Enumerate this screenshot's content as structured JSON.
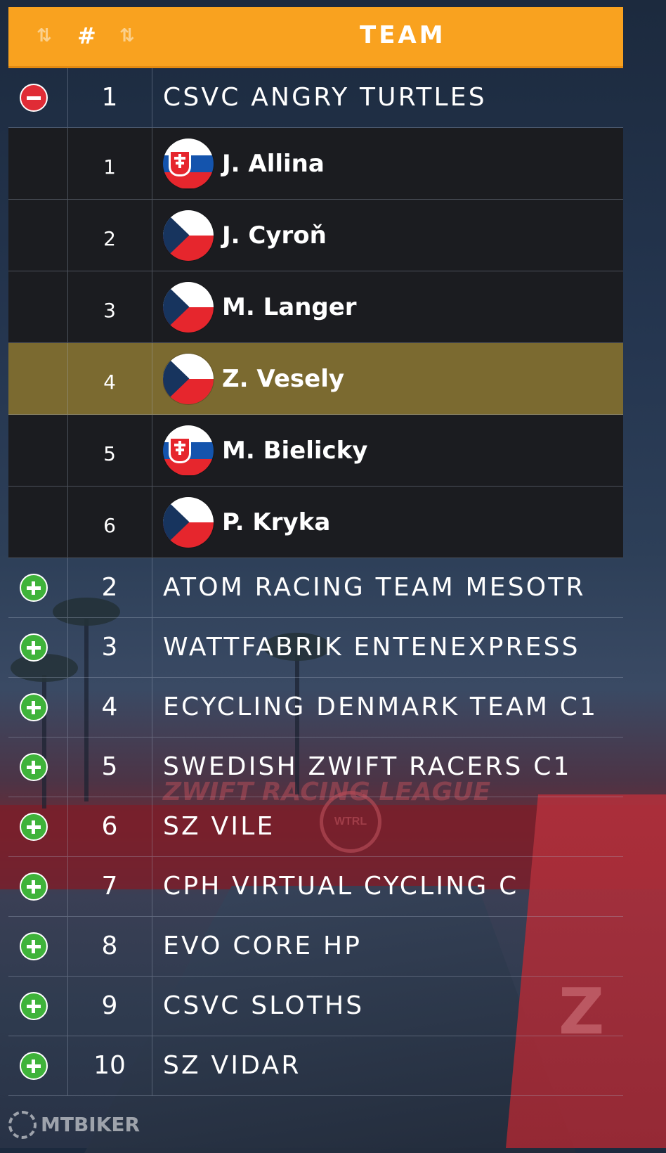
{
  "header": {
    "sort_icon_left": "⇅",
    "rank_label": "#",
    "sort_icon_right": "⇅",
    "team_label": "TEAM"
  },
  "expanded_team": {
    "rank": "1",
    "name": "CSVC ANGRY TURTLES",
    "toggle": "minus",
    "riders": [
      {
        "rank": "1",
        "name": "J. Allina",
        "flag": "slovakia-flag"
      },
      {
        "rank": "2",
        "name": "J. Cyroň",
        "flag": "czech-flag"
      },
      {
        "rank": "3",
        "name": "M. Langer",
        "flag": "czech-flag"
      },
      {
        "rank": "4",
        "name": "Z. Vesely",
        "flag": "czech-flag",
        "highlighted": true
      },
      {
        "rank": "5",
        "name": "M. Bielicky",
        "flag": "slovakia-flag"
      },
      {
        "rank": "6",
        "name": "P. Kryka",
        "flag": "czech-flag"
      }
    ]
  },
  "teams": [
    {
      "rank": "2",
      "name": "ATOM RACING TEAM MESOTR",
      "toggle": "plus"
    },
    {
      "rank": "3",
      "name": "WATTFABRIK ENTENEXPRESS",
      "toggle": "plus"
    },
    {
      "rank": "4",
      "name": "ECYCLING DENMARK TEAM C1",
      "toggle": "plus"
    },
    {
      "rank": "5",
      "name": "SWEDISH ZWIFT RACERS C1",
      "toggle": "plus"
    },
    {
      "rank": "6",
      "name": "SZ VILE",
      "toggle": "plus"
    },
    {
      "rank": "7",
      "name": "CPH VIRTUAL CYCLING C",
      "toggle": "plus"
    },
    {
      "rank": "8",
      "name": "EVO CORE HP",
      "toggle": "plus"
    },
    {
      "rank": "9",
      "name": "CSVC SLOTHS",
      "toggle": "plus"
    },
    {
      "rank": "10",
      "name": "SZ VIDAR",
      "toggle": "plus"
    }
  ],
  "background": {
    "league_text": "ZWIFT RACING LEAGUE",
    "wtrl_text": "WTRL"
  },
  "watermark": "MTBIKER",
  "colors": {
    "header": "#f9a21f",
    "highlight_row": "#7b6a30",
    "expand_toggle": "#3fb33a",
    "collapse_toggle": "#e02c36"
  }
}
